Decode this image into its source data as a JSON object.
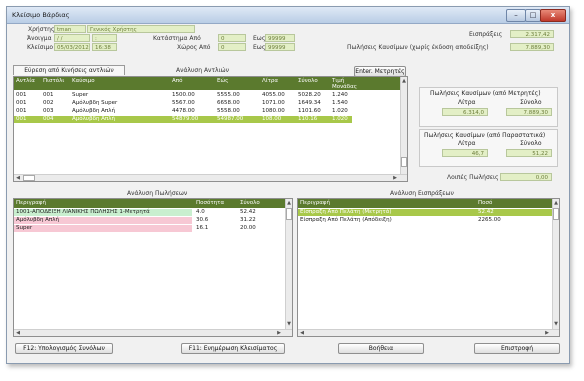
{
  "window": {
    "title": "Κλείσιμο Βάρδιας"
  },
  "header": {
    "xristis_label": "Χρήστης",
    "xristis_code": "tman",
    "xristis_name": "Γενικός Χρήστης",
    "anoigma_label": "Άνοιγμα",
    "anoigma_date": "/ /",
    "anoigma_time": ":",
    "kleisimo_label": "Κλείσιμο",
    "kleisimo_date": "05/03/2012",
    "kleisimo_time": "16:38",
    "katastima_label": "Κατάστημα Από",
    "katastima_from": "0",
    "katastima_to_label": "Εως",
    "katastima_to": "99999",
    "xoros_label": "Χώρος Από",
    "xoros_from": "0",
    "xoros_to_label": "Εως",
    "xoros_to": "99999"
  },
  "summary": {
    "eispraxeis_label": "Εισπράξεις",
    "eispraxeis_value": "2.317,42",
    "poliseis_label": "Πωλήσεις Καυσίμων (χωρίς έκδοση αποδείξης)",
    "poliseis_value": "7.889,30"
  },
  "buttons": {
    "eyresi": "Εύρεση από Κινήσεις αντλιών",
    "enter_metrites": "Εnter. Μετρητές",
    "f12": "F12: Υπολογισμός Συνόλων",
    "f11": "F11: Ενημέρωση Κλεισίματος",
    "help": "Βοήθεια",
    "back": "Επιστροφή"
  },
  "pumps": {
    "title": "Ανάλυση Αντλιών",
    "headers": [
      "Αντλία",
      "Πιστόλι",
      "Καύσιμο",
      "Από",
      "Εώς",
      "Λίτρα",
      "Σύνολο",
      "Τιμή Μονάδας"
    ],
    "rows": [
      {
        "c": [
          "001",
          "001",
          "Super",
          "1500.00",
          "5555.00",
          "4055.00",
          "5028.20",
          "1.240"
        ]
      },
      {
        "c": [
          "001",
          "002",
          "Αμόλυβδη Super",
          "5567.00",
          "6658.00",
          "1071.00",
          "1649.34",
          "1.540"
        ]
      },
      {
        "c": [
          "001",
          "003",
          "Αμόλυβδη Απλή",
          "4478.00",
          "5558.00",
          "1080.00",
          "1101.60",
          "1.020"
        ]
      },
      {
        "c": [
          "001",
          "004",
          "Αμόλυβδη Απλή",
          "54879.00",
          "54987.00",
          "108.00",
          "110.16",
          "1.020"
        ]
      }
    ]
  },
  "meter_panel": {
    "title": "Πωλήσεις Καυσίμων (από Μετρητές)",
    "litra_label": "Λίτρα",
    "synolo_label": "Σύνολο",
    "litra_value": "6.314,0",
    "synolo_value": "7.889,30"
  },
  "receipt_panel": {
    "title": "Πωλήσεις Καυσίμων (από Παραστατικά)",
    "litra_label": "Λίτρα",
    "synolo_label": "Σύνολο",
    "litra_value": "46,7",
    "synolo_value": "51,22"
  },
  "loipes": {
    "label": "Λοιπές Πωλήσεις",
    "value": "0,00"
  },
  "sales": {
    "title": "Ανάλυση Πωλήσεων",
    "headers": [
      "Περιγραφή",
      "Ποσότητα",
      "Σύνολο"
    ],
    "rows": [
      {
        "c": [
          "1001-ΑΠΟΔΕΙΞΗ ΛΙΑΝΙΚΗΣ ΠΩΛΗΣΗΣ 1-Μετρητά",
          "4.0",
          "52.42"
        ]
      },
      {
        "c": [
          "Αμόλυβδη Απλή",
          "30.6",
          "31.22"
        ]
      },
      {
        "c": [
          "Super",
          "16.1",
          "20.00"
        ]
      }
    ]
  },
  "receipts": {
    "title": "Ανάλυση Εισπράξεων",
    "headers": [
      "Περιγραφή",
      "Ποσό"
    ],
    "rows": [
      {
        "c": [
          "Είσπραξη Από Πελάτη (Μετρητά)",
          "52.42"
        ]
      },
      {
        "c": [
          "Είσπραξη Από Πελάτη (Απόδειξη)",
          "2265.00"
        ]
      }
    ]
  },
  "colors": {
    "grid_header": "#5b7a2e",
    "row_selected": "#a8c84a",
    "field_bg": "#e3efc6",
    "row_pink": "#f7c8d4"
  },
  "icons": {
    "minimize": "minimize-icon",
    "maximize": "maximize-icon",
    "close": "close-icon"
  }
}
